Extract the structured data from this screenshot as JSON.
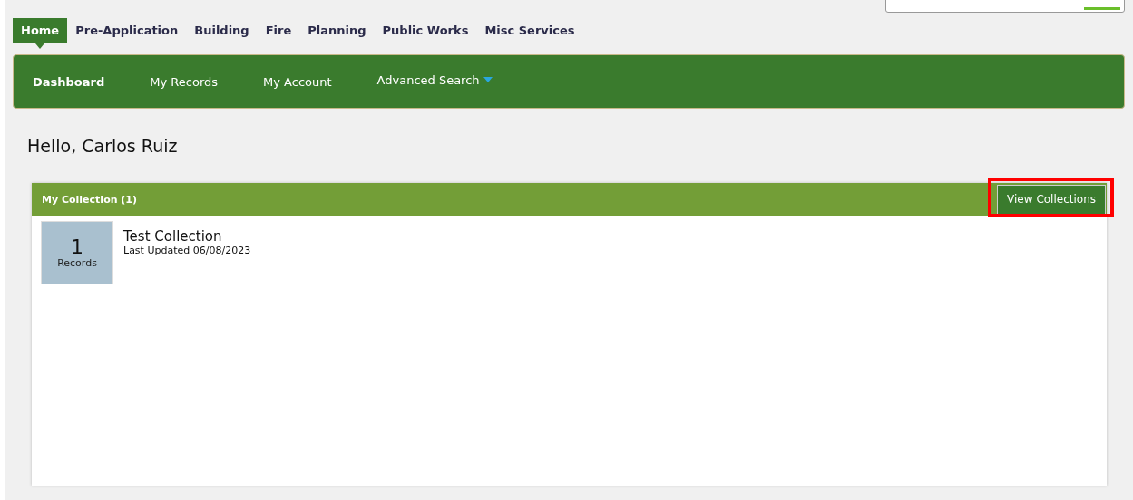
{
  "tabs": [
    {
      "label": "Home",
      "selected": true
    },
    {
      "label": "Pre-Application",
      "selected": false
    },
    {
      "label": "Building",
      "selected": false
    },
    {
      "label": "Fire",
      "selected": false
    },
    {
      "label": "Planning",
      "selected": false
    },
    {
      "label": "Public Works",
      "selected": false
    },
    {
      "label": "Misc Services",
      "selected": false
    }
  ],
  "subnav": [
    {
      "label": "Dashboard",
      "selected": true,
      "dropdown": false
    },
    {
      "label": "My Records",
      "selected": false,
      "dropdown": false
    },
    {
      "label": "My Account",
      "selected": false,
      "dropdown": false
    },
    {
      "label": "Advanced Search",
      "selected": false,
      "dropdown": true
    }
  ],
  "greeting": "Hello, Carlos Ruiz",
  "collection_panel": {
    "title": "My Collection (1)",
    "button": "View Collections",
    "button_highlighted": true,
    "items": [
      {
        "count": "1",
        "count_label": "Records",
        "name": "Test Collection",
        "updated": "Last Updated 06/08/2023"
      }
    ]
  }
}
